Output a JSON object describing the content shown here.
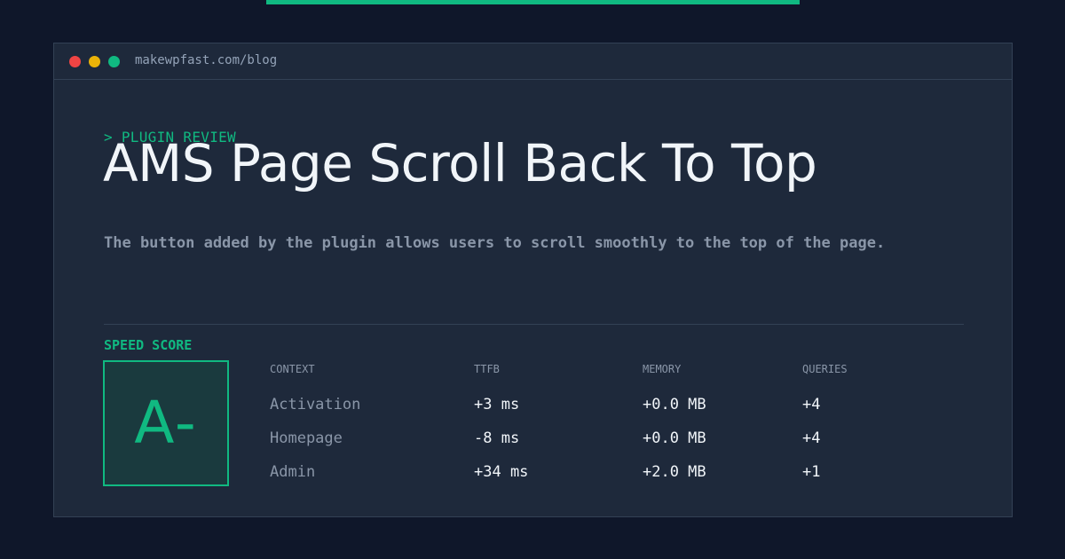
{
  "window": {
    "url": "makewpfast.com/blog"
  },
  "article": {
    "kicker": "> PLUGIN REVIEW",
    "title": "AMS Page Scroll Back To Top",
    "description": "The button added by the plugin allows users to scroll smoothly to the top of the page."
  },
  "score": {
    "label": "SPEED SCORE",
    "grade": "A-"
  },
  "metrics": {
    "headers": [
      "CONTEXT",
      "TTFB",
      "MEMORY",
      "QUERIES"
    ],
    "rows": [
      [
        "Activation",
        "+3 ms",
        "+0.0 MB",
        "+4"
      ],
      [
        "Homepage",
        "-8 ms",
        "+0.0 MB",
        "+4"
      ],
      [
        "Admin",
        "+34 ms",
        "+2.0 MB",
        "+1"
      ]
    ]
  },
  "colors": {
    "accent": "#10b981",
    "background": "#0f172a",
    "panel": "#1e293b",
    "close_dot": "#ef4444",
    "minimize_dot": "#eab308",
    "maximize_dot": "#10b981"
  }
}
